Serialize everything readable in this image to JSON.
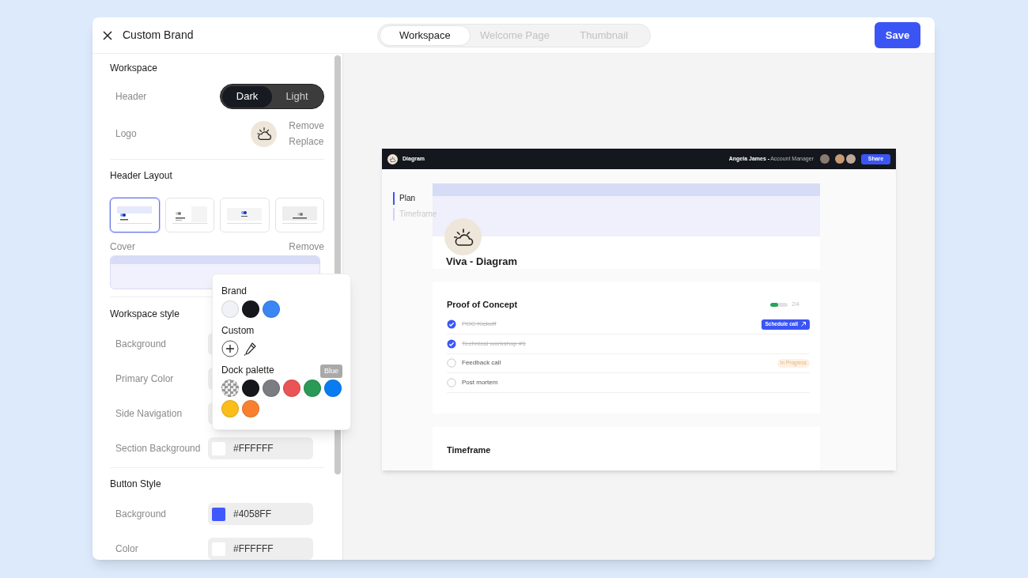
{
  "dialog": {
    "title": "Custom Brand",
    "save_button": "Save"
  },
  "tabs": [
    {
      "label": "Workspace",
      "selected": true
    },
    {
      "label": "Welcome Page",
      "selected": false
    },
    {
      "label": "Thumbnail",
      "selected": false
    }
  ],
  "workspace": {
    "title": "Workspace",
    "header_label": "Header",
    "header_options": [
      {
        "label": "Dark",
        "selected": true
      },
      {
        "label": "Light",
        "selected": false
      }
    ],
    "logo_label": "Logo",
    "logo_actions": [
      "Remove",
      "Replace"
    ]
  },
  "header_layout": {
    "title": "Header Layout",
    "layouts": [
      {
        "kind": "left",
        "selected": true
      },
      {
        "kind": "split",
        "selected": false
      },
      {
        "kind": "center",
        "selected": false
      },
      {
        "kind": "underline",
        "selected": false
      }
    ]
  },
  "cover": {
    "label": "Cover",
    "action": "Remove"
  },
  "workspace_style": {
    "title": "Workspace style",
    "rows": [
      {
        "label": "Background"
      },
      {
        "label": "Primary Color"
      },
      {
        "label": "Side Navigation"
      },
      {
        "label": "Section Background",
        "value": "#FFFFFF",
        "color": "#ffffff"
      }
    ]
  },
  "button_style": {
    "title": "Button Style",
    "rows": [
      {
        "label": "Background",
        "value": "#4058FF",
        "color": "#4058ff"
      },
      {
        "label": "Color",
        "value": "#FFFFFF",
        "color": "#ffffff"
      }
    ]
  },
  "color_popover": {
    "tooltip": "Blue",
    "sections": [
      {
        "title": "Brand",
        "kind": "swatches",
        "swatches": [
          {
            "kind": "solid",
            "color": "#f1f2f8"
          },
          {
            "kind": "solid",
            "color": "#15171c"
          },
          {
            "kind": "solid",
            "color": "#3b86f5"
          }
        ]
      },
      {
        "title": "Custom",
        "kind": "custom"
      },
      {
        "title": "Dock palette",
        "kind": "swatches",
        "swatches": [
          {
            "kind": "transparent"
          },
          {
            "kind": "solid",
            "color": "#15171c"
          },
          {
            "kind": "solid",
            "color": "#7b7d82"
          },
          {
            "kind": "solid",
            "color": "#ea5455"
          },
          {
            "kind": "solid",
            "color": "#2a9a56"
          },
          {
            "kind": "solid",
            "color": "#0a7cf2"
          },
          {
            "kind": "solid",
            "color": "#fbbd18"
          },
          {
            "kind": "solid",
            "color": "#f9802f"
          }
        ]
      }
    ]
  },
  "preview": {
    "app_title": "Diagram",
    "user_name": "Angela James -",
    "user_role": "Account Manager",
    "share_button": "Share",
    "nav": [
      {
        "label": "Plan",
        "selected": true
      },
      {
        "label": "Timeframe",
        "selected": false
      }
    ],
    "page_title": "Viva - Diagram",
    "sections": [
      {
        "title": "Proof of Concept",
        "progress": {
          "level": 0.45,
          "reading": "2/4"
        },
        "tasks": [
          {
            "label": "POC Kickoff",
            "checked": true,
            "action": "Schedule call"
          },
          {
            "label": "Technical workshop #1",
            "checked": true
          },
          {
            "label": "Feedback call",
            "checked": false,
            "status": "In Progress"
          },
          {
            "label": "Post mortem",
            "checked": false
          }
        ]
      },
      {
        "title": "Timeframe"
      }
    ]
  }
}
